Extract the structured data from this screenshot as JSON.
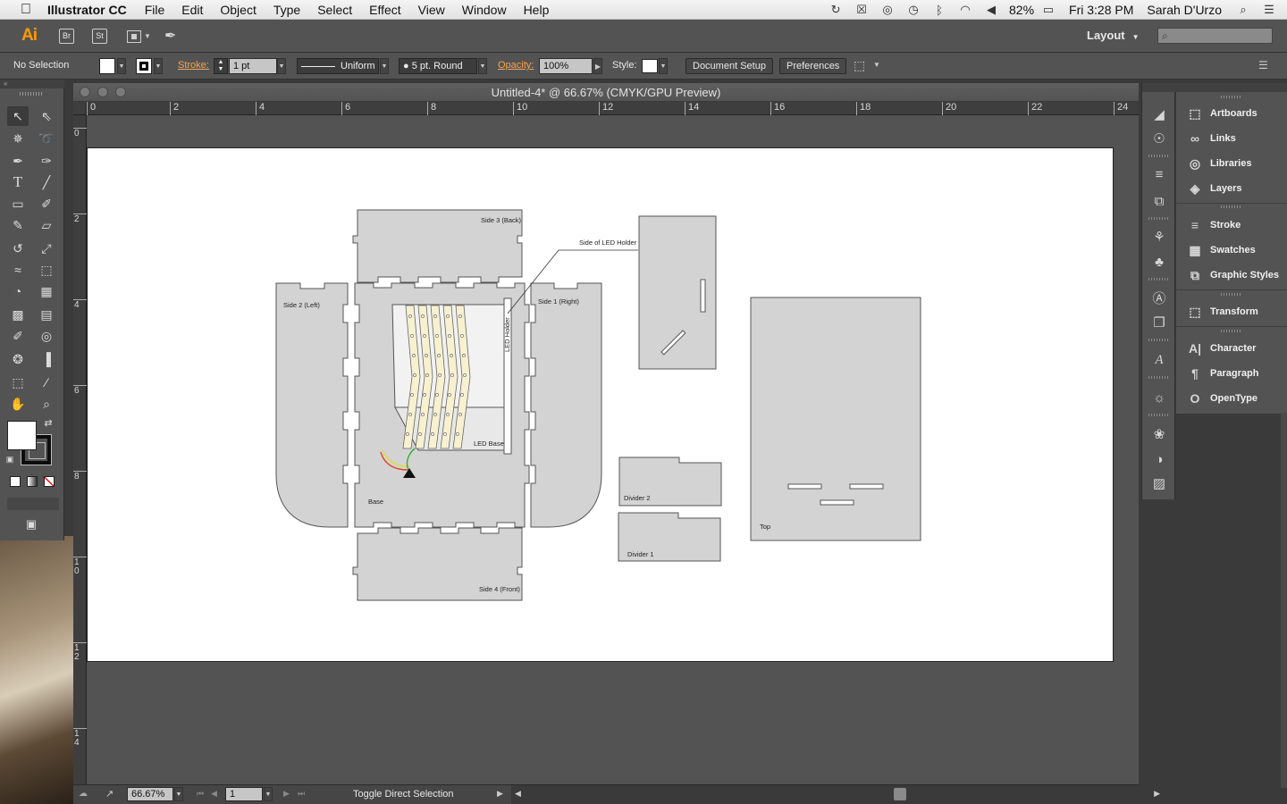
{
  "menubar": {
    "app_name": "Illustrator CC",
    "items": [
      "File",
      "Edit",
      "Object",
      "Type",
      "Select",
      "Effect",
      "View",
      "Window",
      "Help"
    ],
    "battery": "82%",
    "clock": "Fri 3:28 PM",
    "user": "Sarah D'Urzo"
  },
  "appbar": {
    "logo": "Ai",
    "bridge": "Br",
    "stock": "St",
    "workspace": "Layout"
  },
  "control": {
    "selection": "No Selection",
    "stroke_label": "Stroke:",
    "stroke_weight": "1 pt",
    "stroke_profile": "Uniform",
    "brush": "5 pt. Round",
    "opacity_label": "Opacity:",
    "opacity": "100%",
    "style_label": "Style:",
    "document_setup": "Document Setup",
    "preferences": "Preferences"
  },
  "document": {
    "title": "Untitled-4* @ 66.67% (CMYK/GPU Preview)",
    "h_ruler": [
      "0",
      "2",
      "4",
      "6",
      "8",
      "10",
      "12",
      "14",
      "16",
      "18",
      "20",
      "22",
      "24"
    ],
    "v_ruler": [
      "0",
      "2",
      "4",
      "6",
      "8",
      "10",
      "12",
      "14"
    ]
  },
  "artwork": {
    "side3": "Side 3 (Back)",
    "side2": "Side 2 (Left)",
    "side1": "Side 1 (Right)",
    "side4": "Side 4 (Front)",
    "base": "Base",
    "led_base": "LED Base",
    "led_holder": "LED Holder",
    "side_led_holder": "Side of LED Holder",
    "divider1": "Divider 1",
    "divider2": "Divider 2",
    "top": "Top"
  },
  "statusbar": {
    "zoom": "66.67%",
    "artboard": "1",
    "status": "Toggle Direct Selection"
  },
  "panels": [
    {
      "label": "Artboards",
      "icon": "artboards-icon"
    },
    {
      "label": "Links",
      "icon": "links-icon"
    },
    {
      "label": "Libraries",
      "icon": "libraries-icon"
    },
    {
      "label": "Layers",
      "icon": "layers-icon"
    },
    {
      "label": "Stroke",
      "icon": "stroke-icon"
    },
    {
      "label": "Swatches",
      "icon": "swatches-icon"
    },
    {
      "label": "Graphic Styles",
      "icon": "graphic-styles-icon"
    },
    {
      "label": "Transform",
      "icon": "transform-icon"
    },
    {
      "label": "Character",
      "icon": "character-icon"
    },
    {
      "label": "Paragraph",
      "icon": "paragraph-icon"
    },
    {
      "label": "OpenType",
      "icon": "opentype-icon"
    }
  ],
  "colors": {
    "accent": "#ff9a00",
    "panel_bg": "#535353",
    "piece_fill": "#d3d3d3"
  }
}
